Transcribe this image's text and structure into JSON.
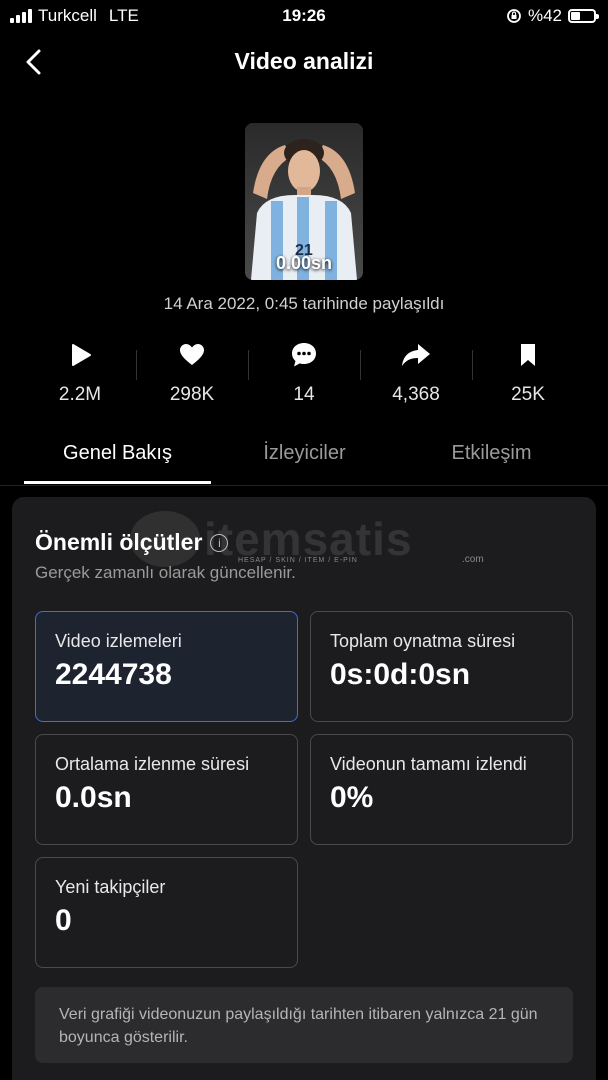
{
  "status_bar": {
    "carrier": "Turkcell",
    "network": "LTE",
    "time": "19:26",
    "battery_text": "%42",
    "battery_level": 0.42
  },
  "header": {
    "title": "Video analizi",
    "back_icon": "chevron-left-icon"
  },
  "video": {
    "duration_overlay": "0.00sn",
    "shared_text": "14 Ara 2022, 0:45 tarihinde paylaşıldı"
  },
  "stats": [
    {
      "icon": "play-icon",
      "value": "2.2M"
    },
    {
      "icon": "heart-icon",
      "value": "298K"
    },
    {
      "icon": "comment-icon",
      "value": "14"
    },
    {
      "icon": "share-icon",
      "value": "4,368"
    },
    {
      "icon": "bookmark-icon",
      "value": "25K"
    }
  ],
  "tabs": [
    {
      "label": "Genel Bakış",
      "active": true
    },
    {
      "label": "İzleyiciler",
      "active": false
    },
    {
      "label": "Etkileşim",
      "active": false
    }
  ],
  "card": {
    "title": "Önemli ölçütler",
    "info_icon": "info-icon",
    "subtitle": "Gerçek zamanlı olarak güncellenir.",
    "watermark": {
      "name": "itemsatis",
      "tagline": "HESAP / SKIN / ITEM / E-PIN",
      "suffix": ".com"
    },
    "metrics": [
      {
        "label": "Video izlemeleri",
        "value": "2244738",
        "selected": true
      },
      {
        "label": "Toplam oynatma süresi",
        "value": "0s:0d:0sn",
        "selected": false
      },
      {
        "label": "Ortalama izlenme süresi",
        "value": "0.0sn",
        "selected": false
      },
      {
        "label": "Videonun tamamı izlendi",
        "value": "0%",
        "selected": false
      },
      {
        "label": "Yeni takipçiler",
        "value": "0",
        "selected": false
      }
    ],
    "note": "Veri grafiği videonuzun paylaşıldığı tarihten itibaren yalnızca 21 gün boyunca gösterilir."
  },
  "colors": {
    "background": "#000000",
    "card": "#1c1c1e",
    "selected_border": "#3b6fd4",
    "muted_text": "#9a9a9a"
  }
}
